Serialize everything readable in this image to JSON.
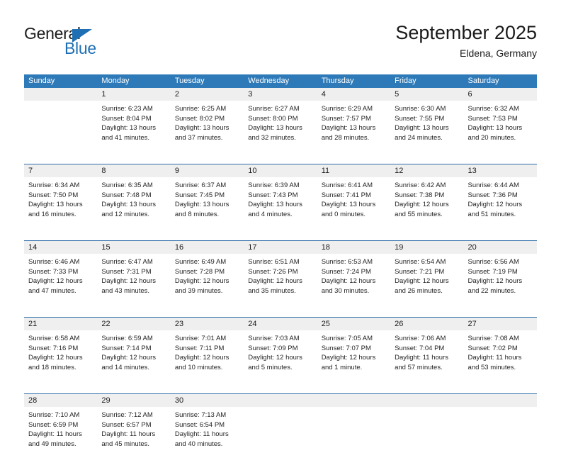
{
  "brand": {
    "name_top": "General",
    "name_bottom": "Blue",
    "triangle_color": "#1f6fb5",
    "top_color": "#1b1b1b"
  },
  "header": {
    "title": "September 2025",
    "subtitle": "Eldena, Germany"
  },
  "theme": {
    "header_bg": "#2e7ab8",
    "week_divider": "#2e6da8",
    "daynum_band": "#efefef",
    "text": "#222222"
  },
  "weekdays": [
    "Sunday",
    "Monday",
    "Tuesday",
    "Wednesday",
    "Thursday",
    "Friday",
    "Saturday"
  ],
  "weeks": [
    {
      "days": [
        {
          "num": "",
          "lines": []
        },
        {
          "num": "1",
          "lines": [
            "Sunrise: 6:23 AM",
            "Sunset: 8:04 PM",
            "Daylight: 13 hours",
            "and 41 minutes."
          ]
        },
        {
          "num": "2",
          "lines": [
            "Sunrise: 6:25 AM",
            "Sunset: 8:02 PM",
            "Daylight: 13 hours",
            "and 37 minutes."
          ]
        },
        {
          "num": "3",
          "lines": [
            "Sunrise: 6:27 AM",
            "Sunset: 8:00 PM",
            "Daylight: 13 hours",
            "and 32 minutes."
          ]
        },
        {
          "num": "4",
          "lines": [
            "Sunrise: 6:29 AM",
            "Sunset: 7:57 PM",
            "Daylight: 13 hours",
            "and 28 minutes."
          ]
        },
        {
          "num": "5",
          "lines": [
            "Sunrise: 6:30 AM",
            "Sunset: 7:55 PM",
            "Daylight: 13 hours",
            "and 24 minutes."
          ]
        },
        {
          "num": "6",
          "lines": [
            "Sunrise: 6:32 AM",
            "Sunset: 7:53 PM",
            "Daylight: 13 hours",
            "and 20 minutes."
          ]
        }
      ]
    },
    {
      "days": [
        {
          "num": "7",
          "lines": [
            "Sunrise: 6:34 AM",
            "Sunset: 7:50 PM",
            "Daylight: 13 hours",
            "and 16 minutes."
          ]
        },
        {
          "num": "8",
          "lines": [
            "Sunrise: 6:35 AM",
            "Sunset: 7:48 PM",
            "Daylight: 13 hours",
            "and 12 minutes."
          ]
        },
        {
          "num": "9",
          "lines": [
            "Sunrise: 6:37 AM",
            "Sunset: 7:45 PM",
            "Daylight: 13 hours",
            "and 8 minutes."
          ]
        },
        {
          "num": "10",
          "lines": [
            "Sunrise: 6:39 AM",
            "Sunset: 7:43 PM",
            "Daylight: 13 hours",
            "and 4 minutes."
          ]
        },
        {
          "num": "11",
          "lines": [
            "Sunrise: 6:41 AM",
            "Sunset: 7:41 PM",
            "Daylight: 13 hours",
            "and 0 minutes."
          ]
        },
        {
          "num": "12",
          "lines": [
            "Sunrise: 6:42 AM",
            "Sunset: 7:38 PM",
            "Daylight: 12 hours",
            "and 55 minutes."
          ]
        },
        {
          "num": "13",
          "lines": [
            "Sunrise: 6:44 AM",
            "Sunset: 7:36 PM",
            "Daylight: 12 hours",
            "and 51 minutes."
          ]
        }
      ]
    },
    {
      "days": [
        {
          "num": "14",
          "lines": [
            "Sunrise: 6:46 AM",
            "Sunset: 7:33 PM",
            "Daylight: 12 hours",
            "and 47 minutes."
          ]
        },
        {
          "num": "15",
          "lines": [
            "Sunrise: 6:47 AM",
            "Sunset: 7:31 PM",
            "Daylight: 12 hours",
            "and 43 minutes."
          ]
        },
        {
          "num": "16",
          "lines": [
            "Sunrise: 6:49 AM",
            "Sunset: 7:28 PM",
            "Daylight: 12 hours",
            "and 39 minutes."
          ]
        },
        {
          "num": "17",
          "lines": [
            "Sunrise: 6:51 AM",
            "Sunset: 7:26 PM",
            "Daylight: 12 hours",
            "and 35 minutes."
          ]
        },
        {
          "num": "18",
          "lines": [
            "Sunrise: 6:53 AM",
            "Sunset: 7:24 PM",
            "Daylight: 12 hours",
            "and 30 minutes."
          ]
        },
        {
          "num": "19",
          "lines": [
            "Sunrise: 6:54 AM",
            "Sunset: 7:21 PM",
            "Daylight: 12 hours",
            "and 26 minutes."
          ]
        },
        {
          "num": "20",
          "lines": [
            "Sunrise: 6:56 AM",
            "Sunset: 7:19 PM",
            "Daylight: 12 hours",
            "and 22 minutes."
          ]
        }
      ]
    },
    {
      "days": [
        {
          "num": "21",
          "lines": [
            "Sunrise: 6:58 AM",
            "Sunset: 7:16 PM",
            "Daylight: 12 hours",
            "and 18 minutes."
          ]
        },
        {
          "num": "22",
          "lines": [
            "Sunrise: 6:59 AM",
            "Sunset: 7:14 PM",
            "Daylight: 12 hours",
            "and 14 minutes."
          ]
        },
        {
          "num": "23",
          "lines": [
            "Sunrise: 7:01 AM",
            "Sunset: 7:11 PM",
            "Daylight: 12 hours",
            "and 10 minutes."
          ]
        },
        {
          "num": "24",
          "lines": [
            "Sunrise: 7:03 AM",
            "Sunset: 7:09 PM",
            "Daylight: 12 hours",
            "and 5 minutes."
          ]
        },
        {
          "num": "25",
          "lines": [
            "Sunrise: 7:05 AM",
            "Sunset: 7:07 PM",
            "Daylight: 12 hours",
            "and 1 minute."
          ]
        },
        {
          "num": "26",
          "lines": [
            "Sunrise: 7:06 AM",
            "Sunset: 7:04 PM",
            "Daylight: 11 hours",
            "and 57 minutes."
          ]
        },
        {
          "num": "27",
          "lines": [
            "Sunrise: 7:08 AM",
            "Sunset: 7:02 PM",
            "Daylight: 11 hours",
            "and 53 minutes."
          ]
        }
      ]
    },
    {
      "days": [
        {
          "num": "28",
          "lines": [
            "Sunrise: 7:10 AM",
            "Sunset: 6:59 PM",
            "Daylight: 11 hours",
            "and 49 minutes."
          ]
        },
        {
          "num": "29",
          "lines": [
            "Sunrise: 7:12 AM",
            "Sunset: 6:57 PM",
            "Daylight: 11 hours",
            "and 45 minutes."
          ]
        },
        {
          "num": "30",
          "lines": [
            "Sunrise: 7:13 AM",
            "Sunset: 6:54 PM",
            "Daylight: 11 hours",
            "and 40 minutes."
          ]
        },
        {
          "num": "",
          "lines": []
        },
        {
          "num": "",
          "lines": []
        },
        {
          "num": "",
          "lines": []
        },
        {
          "num": "",
          "lines": []
        }
      ]
    }
  ]
}
